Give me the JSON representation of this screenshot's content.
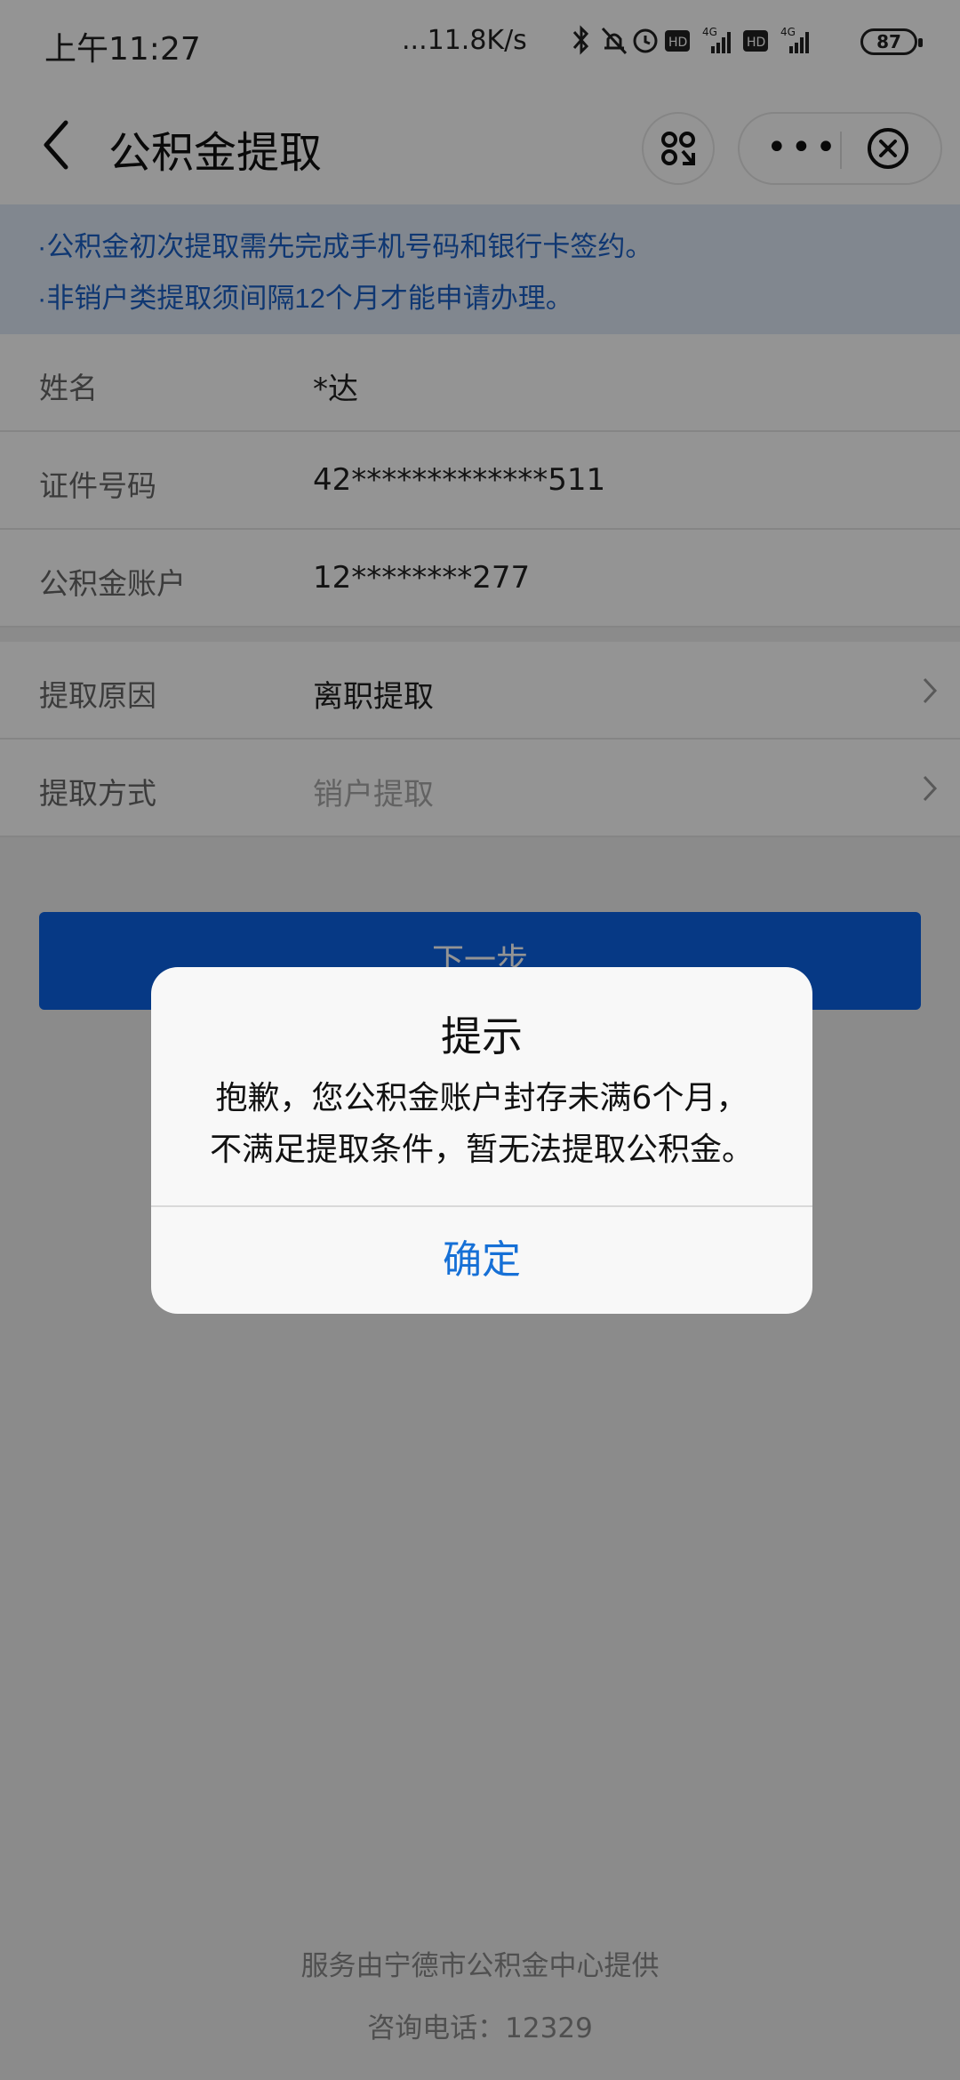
{
  "status_bar": {
    "time": "上午11:27",
    "speed": "...11.8K/s",
    "icons": [
      "bluetooth-icon",
      "mute-icon",
      "alarm-icon",
      "hd-icon",
      "4g-signal-icon",
      "hd-icon",
      "4g-signal-icon"
    ],
    "battery": "87"
  },
  "header": {
    "title": "公积金提取"
  },
  "notice": {
    "line1": "·公积金初次提取需先完成手机号码和银行卡签约。",
    "line2": "·非销户类提取须间隔12个月才能申请办理。"
  },
  "form": {
    "rows": [
      {
        "label": "姓名",
        "value": "*达"
      },
      {
        "label": "证件号码",
        "value": "42*************511"
      },
      {
        "label": "公积金账户",
        "value": "12********277"
      },
      {
        "label": "提取原因",
        "value": "离职提取"
      },
      {
        "label": "提取方式",
        "value": "销户提取"
      }
    ]
  },
  "next_button": "下一步",
  "footer": {
    "provider": "服务由宁德市公积金中心提供",
    "phone": "咨询电话：12329"
  },
  "dialog": {
    "title": "提示",
    "line1": "抱歉，您公积金账户封存未满6个月，",
    "line2": "不满足提取条件，暂无法提取公积金。",
    "ok": "确定"
  },
  "colors": {
    "primary": "#0b62e6",
    "notice_text": "#1a5fc4",
    "notice_bg": "#dfe9f7",
    "dialog_button": "#1670d6"
  }
}
